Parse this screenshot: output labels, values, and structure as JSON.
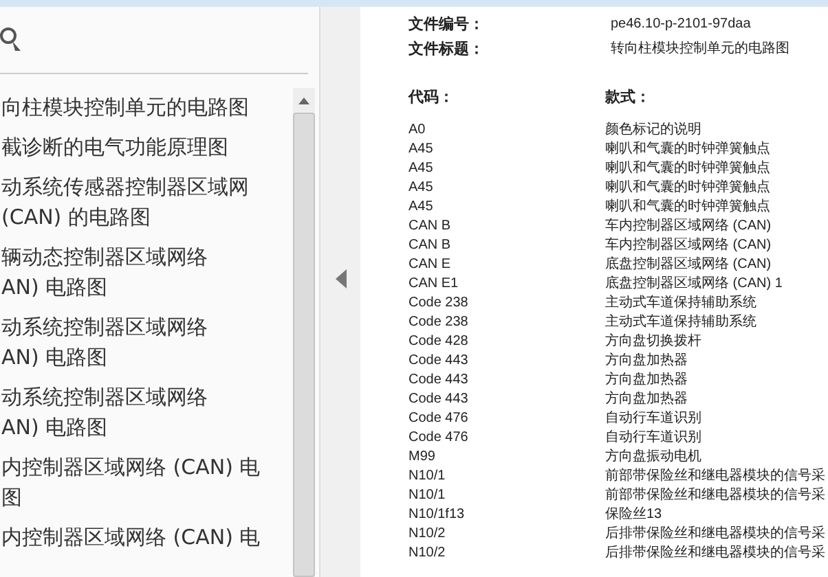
{
  "sidebar": {
    "items": [
      {
        "lines": [
          "向柱模块控制单元的电路图"
        ],
        "selected": false
      },
      {
        "lines": [
          "截诊断的电气功能原理图"
        ],
        "selected": false
      },
      {
        "lines": [
          "动系统传感器控制器区域网",
          "(CAN) 的电路图"
        ],
        "selected": false
      },
      {
        "lines": [
          "辆动态控制器区域网络",
          "AN) 电路图"
        ],
        "selected": false
      },
      {
        "lines": [
          "动系统控制器区域网络",
          "AN) 电路图"
        ],
        "selected": false
      },
      {
        "lines": [
          "动系统控制器区域网络",
          "AN) 电路图"
        ],
        "selected": false
      },
      {
        "lines": [
          "内控制器区域网络 (CAN) 电",
          "图"
        ],
        "selected": false
      },
      {
        "lines": [
          "内控制器区域网络 (CAN) 电"
        ],
        "selected": false
      }
    ]
  },
  "document": {
    "fields": [
      {
        "label": "文件编号：",
        "value": "pe46.10-p-2101-97daa"
      },
      {
        "label": "文件标题：",
        "value": "转向柱模块控制单元的电路图"
      }
    ],
    "table": {
      "columns": [
        "代码：",
        "款式："
      ],
      "rows": [
        [
          "A0",
          "颜色标记的说明"
        ],
        [
          "A45",
          "喇叭和气囊的时钟弹簧触点"
        ],
        [
          "A45",
          "喇叭和气囊的时钟弹簧触点"
        ],
        [
          "A45",
          "喇叭和气囊的时钟弹簧触点"
        ],
        [
          "A45",
          "喇叭和气囊的时钟弹簧触点"
        ],
        [
          "CAN B",
          "车内控制器区域网络 (CAN)"
        ],
        [
          "CAN B",
          "车内控制器区域网络 (CAN)"
        ],
        [
          "CAN E",
          "底盘控制器区域网络 (CAN)"
        ],
        [
          "CAN E1",
          "底盘控制器区域网络 (CAN) 1"
        ],
        [
          "Code 238",
          "主动式车道保持辅助系统"
        ],
        [
          "Code 238",
          "主动式车道保持辅助系统"
        ],
        [
          "Code 428",
          "方向盘切换拨杆"
        ],
        [
          "Code 443",
          "方向盘加热器"
        ],
        [
          "Code 443",
          "方向盘加热器"
        ],
        [
          "Code 443",
          "方向盘加热器"
        ],
        [
          "Code 476",
          "自动行车道识别"
        ],
        [
          "Code 476",
          "自动行车道识别"
        ],
        [
          "M99",
          "方向盘振动电机"
        ],
        [
          "N10/1",
          "前部带保险丝和继电器模块的信号采"
        ],
        [
          "N10/1",
          "前部带保险丝和继电器模块的信号采"
        ],
        [
          "N10/1f13",
          "保险丝13"
        ],
        [
          "N10/2",
          "后排带保险丝和继电器模块的信号采"
        ],
        [
          "N10/2",
          "后排带保险丝和继电器模块的信号采"
        ]
      ]
    }
  }
}
